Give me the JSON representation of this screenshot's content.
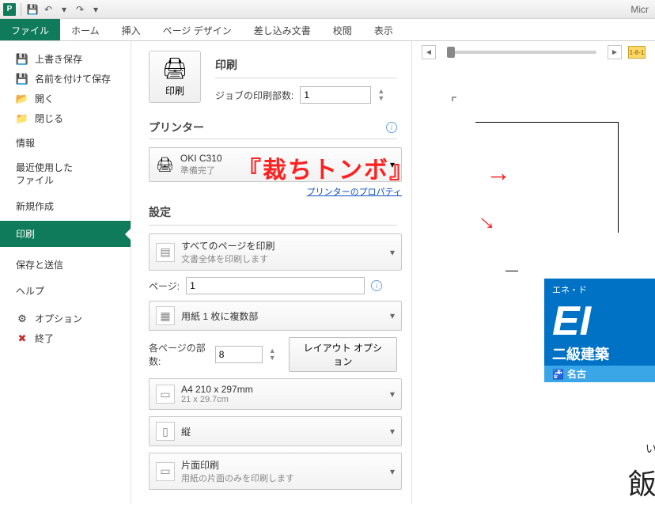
{
  "qat": {
    "app_title": "Micr",
    "undo": "↶",
    "redo": "↷"
  },
  "ribbon": {
    "tabs": [
      "ファイル",
      "ホーム",
      "挿入",
      "ページ デザイン",
      "差し込み文書",
      "校閲",
      "表示"
    ]
  },
  "sidebar": {
    "save": "上書き保存",
    "save_as": "名前を付けて保存",
    "open": "開く",
    "close": "閉じる",
    "info": "情報",
    "recent": "最近使用した\nファイル",
    "new": "新規作成",
    "print": "印刷",
    "save_send": "保存と送信",
    "help": "ヘルプ",
    "options": "オプション",
    "exit": "終了"
  },
  "print": {
    "title": "印刷",
    "print_btn": "印刷",
    "copies_label": "ジョブの印刷部数:",
    "copies_value": "1",
    "printer_section": "プリンター",
    "printer_name": "OKI C310",
    "printer_status": "準備完了",
    "printer_props": "プリンターのプロパティ",
    "settings_section": "設定",
    "scope_title": "すべてのページを印刷",
    "scope_sub": "文書全体を印刷します",
    "pages_label": "ページ:",
    "pages_value": "1",
    "collate_title": "用紙 1 枚に複数部",
    "copies_per_label": "各ページの部数:",
    "copies_per_value": "8",
    "layout_btn": "レイアウト オプション",
    "paper_title": "A4 210 x 297mm",
    "paper_sub": "21 x 29.7cm",
    "orient_title": "縦",
    "duplex_title": "片面印刷",
    "duplex_sub": "用紙の片面のみを印刷します"
  },
  "preview": {
    "ruler": "1-8-1",
    "banner_small": "エネ・ド",
    "banner_big": "EI",
    "banner_line1": "二級建築",
    "banner_line2": "名古",
    "jp_small": "い",
    "jp_big": "飯"
  },
  "annotation": {
    "label": "『裁ちトンボ』",
    "arrow": "→"
  }
}
